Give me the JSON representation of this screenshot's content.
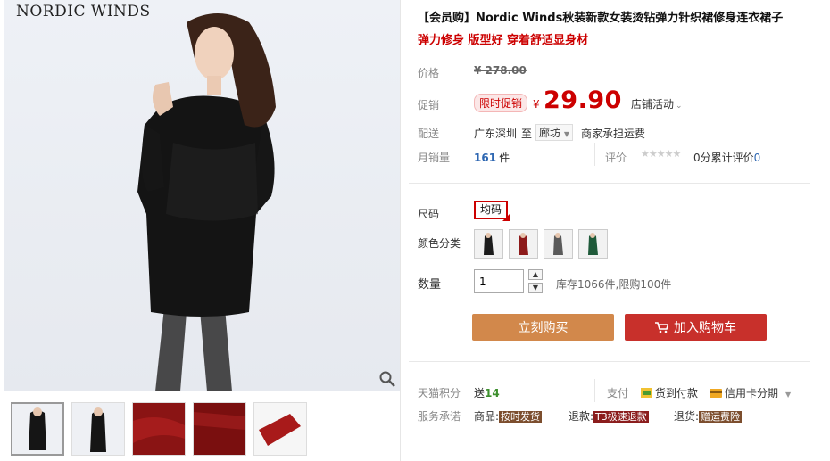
{
  "gallery": {
    "brand_text": "NORDIC WINDS",
    "thumbnails": [
      "thumb-1",
      "thumb-2",
      "thumb-3",
      "thumb-4",
      "thumb-5"
    ]
  },
  "product": {
    "title": "【会员购】Nordic Winds秋装新款女装烫钻弹力针织裙修身连衣裙子",
    "subtitle": "弹力修身 版型好 穿着舒适显身材"
  },
  "price": {
    "label": "价格",
    "original": "¥ 278.00",
    "promo_label_left": "促销",
    "promo_tag": "限时促销",
    "currency": "¥",
    "value": "29.90",
    "store_promo": "店铺活动"
  },
  "shipping": {
    "label": "配送",
    "from": "广东深圳",
    "to_word": "至",
    "city": "廊坊",
    "fee": "商家承担运费"
  },
  "sales": {
    "label": "月销量",
    "count": "161",
    "unit": "件",
    "rating_label": "评价",
    "rating_score": "0分",
    "rating_count": "累计评价",
    "rating_num": "0",
    "stars": 0
  },
  "options": {
    "size_label": "尺码",
    "size_value": "均码",
    "color_label": "颜色分类",
    "colors": [
      "#1c1c1c",
      "#8d1a1a",
      "#5a5a5a",
      "#1f5a3a"
    ],
    "qty_label": "数量",
    "qty_value": "1",
    "stock_text": "库存1066件,限购100件"
  },
  "actions": {
    "buy_now": "立刻购买",
    "add_cart": "加入购物车"
  },
  "bottom": {
    "points_label": "天猫积分",
    "points_prefix": "送",
    "points_value": "14",
    "pay_label": "支付",
    "pay_cod": "货到付款",
    "pay_card": "信用卡分期",
    "service_label": "服务承诺",
    "svc1_prefix": "商品:",
    "svc1_tag": "按时发货",
    "svc2_prefix": "退款:",
    "svc2_tag": "T3极速退款",
    "svc3_prefix": "退货:",
    "svc3_tag": "赠运费险"
  },
  "colors": {
    "accent_red": "#c00000",
    "buy_orange": "#d2884b",
    "cart_red": "#c8302b"
  }
}
